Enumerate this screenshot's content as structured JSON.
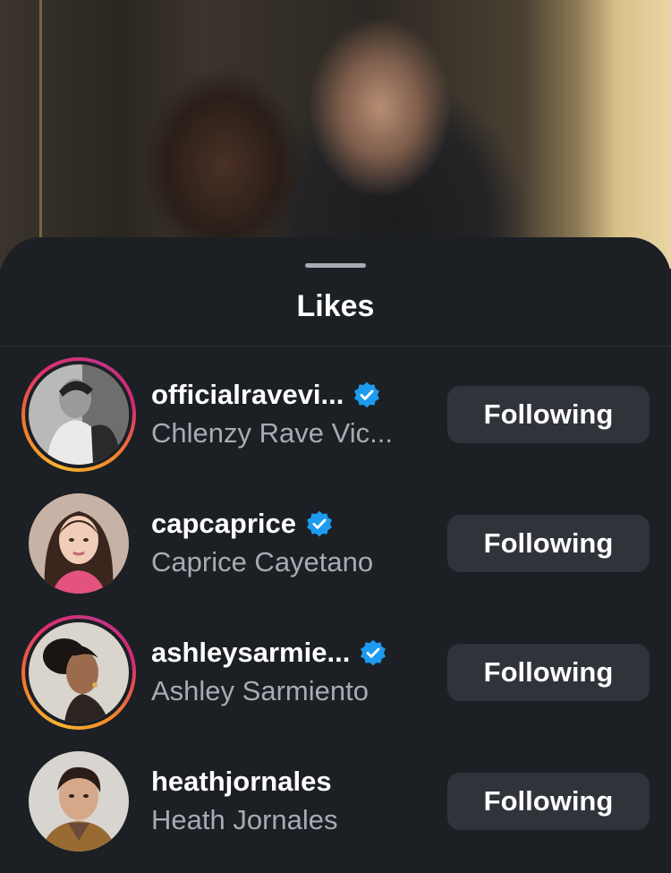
{
  "sheet": {
    "title": "Likes"
  },
  "likes": [
    {
      "username": "officialravevi...",
      "full_name": "Chlenzy Rave Vic...",
      "verified": true,
      "story_ring": true,
      "button_label": "Following"
    },
    {
      "username": "capcaprice",
      "full_name": "Caprice Cayetano",
      "verified": true,
      "story_ring": false,
      "button_label": "Following"
    },
    {
      "username": "ashleysarmie...",
      "full_name": "Ashley Sarmiento",
      "verified": true,
      "story_ring": true,
      "button_label": "Following"
    },
    {
      "username": "heathjornales",
      "full_name": "Heath Jornales",
      "verified": false,
      "story_ring": false,
      "button_label": "Following"
    }
  ],
  "colors": {
    "sheet_bg": "#1c1f24",
    "button_bg": "#30333a",
    "verified_blue": "#1d9bf0",
    "secondary_text": "#a7abb2"
  }
}
